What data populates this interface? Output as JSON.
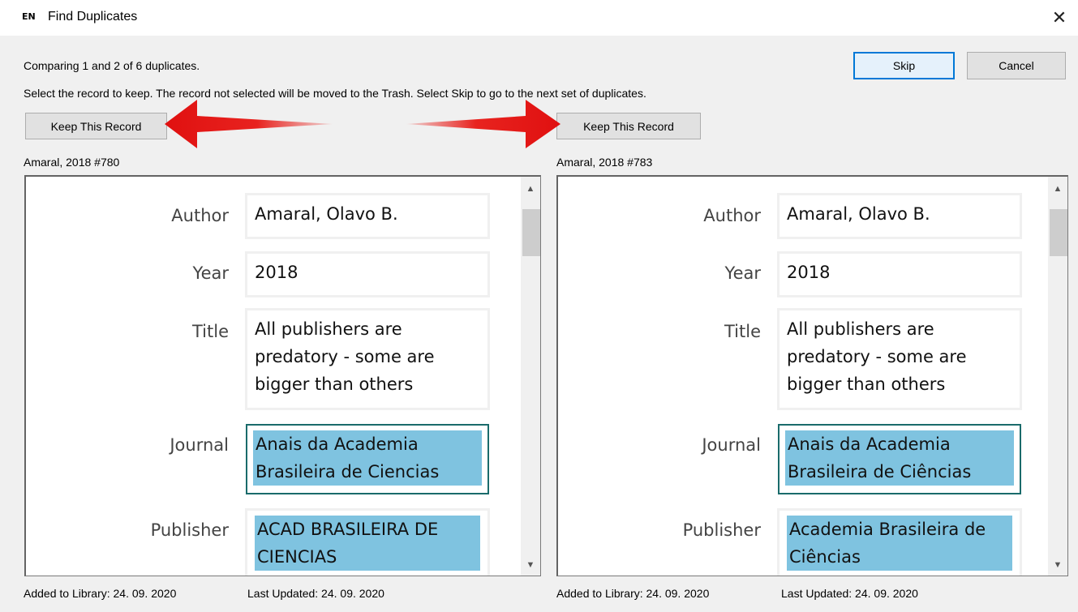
{
  "window": {
    "app_icon": "EN",
    "title": "Find Duplicates",
    "close_glyph": "✕"
  },
  "header": {
    "status": "Comparing 1 and 2 of 6 duplicates.",
    "instructions": "Select the record to keep. The record not selected will be moved to the Trash. Select Skip to go to the next set of duplicates.",
    "skip_label": "Skip",
    "cancel_label": "Cancel"
  },
  "left": {
    "keep_label": "Keep This Record",
    "ref": "Amaral, 2018 #780",
    "fields": {
      "author_label": "Author",
      "author": "Amaral, Olavo B.",
      "year_label": "Year",
      "year": "2018",
      "title_label": "Title",
      "title_l1": "All publishers are",
      "title_l2": "predatory - some are",
      "title_l3": "bigger than others",
      "journal_label": "Journal",
      "journal_l1": "Anais da Academia",
      "journal_l2": "Brasileira de Ciencias",
      "publisher_label": "Publisher",
      "publisher_l1": "ACAD BRASILEIRA DE",
      "publisher_l2": "CIENCIAS"
    },
    "added": "Added to Library: 24. 09. 2020",
    "updated": "Last Updated: 24. 09. 2020"
  },
  "right": {
    "keep_label": "Keep This Record",
    "ref": "Amaral, 2018 #783",
    "fields": {
      "author_label": "Author",
      "author": "Amaral, Olavo B.",
      "year_label": "Year",
      "year": "2018",
      "title_label": "Title",
      "title_l1": "All publishers are",
      "title_l2": "predatory - some are",
      "title_l3": "bigger than others",
      "journal_label": "Journal",
      "journal_l1": "Anais da Academia",
      "journal_l2": "Brasileira de Ciências",
      "publisher_label": "Publisher",
      "publisher_l1": "Academia Brasileira de",
      "publisher_l2": "Ciências"
    },
    "added": "Added to Library: 24. 09. 2020",
    "updated": "Last Updated: 24. 09. 2020"
  },
  "colors": {
    "highlight": "#7fc3e0",
    "selected_border": "#1a6b6b",
    "arrow_red": "#e8231f",
    "focus_blue": "#0078d7"
  }
}
